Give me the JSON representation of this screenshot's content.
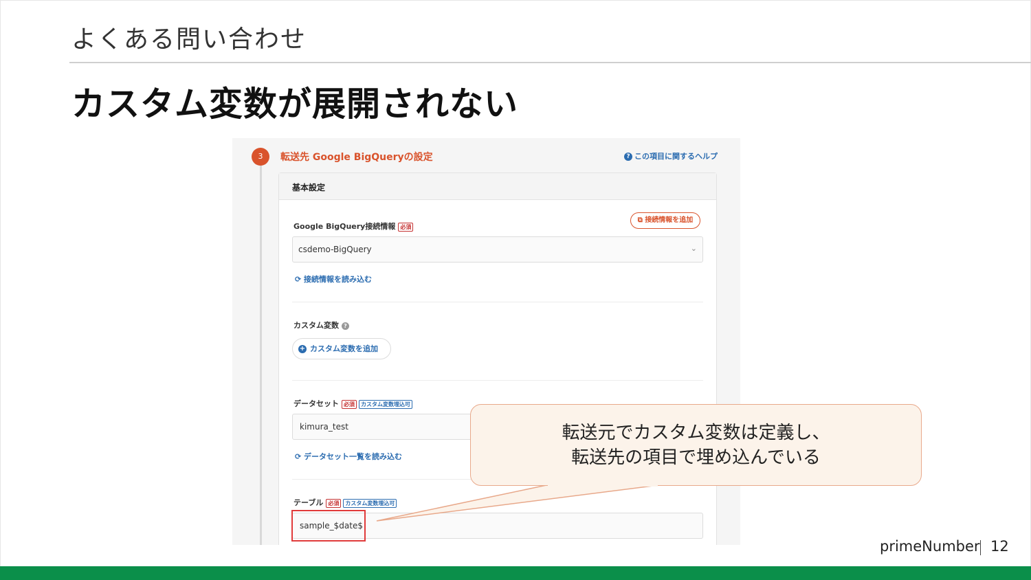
{
  "slide": {
    "section_title": "よくある問い合わせ",
    "title": "カスタム変数が展開されない",
    "brand": "primeNumber",
    "page_number": "12"
  },
  "screenshot": {
    "step_number": "3",
    "step_title": "転送先 Google BigQueryの設定",
    "help_link": "この項目に関するヘルプ",
    "card_header": "基本設定",
    "connection": {
      "label": "Google BigQuery接続情報",
      "required": "必須",
      "add_button": "接続情報を追加",
      "selected_value": "csdemo-BigQuery",
      "reload_link": "接続情報を読み込む"
    },
    "custom_vars": {
      "label": "カスタム変数",
      "add_button": "カスタム変数を追加"
    },
    "dataset": {
      "label": "データセット",
      "required": "必須",
      "tag": "カスタム変数埋込可",
      "value": "kimura_test",
      "reload_link": "データセット一覧を読み込む"
    },
    "table": {
      "label": "テーブル",
      "required": "必須",
      "tag": "カスタム変数埋込可",
      "value": "sample_$date$"
    }
  },
  "callout": {
    "line1": "転送元でカスタム変数は定義し、",
    "line2": "転送先の項目で埋め込んでいる"
  },
  "colors": {
    "accent": "#d9532c",
    "link": "#2b6cb0",
    "footer": "#0b8f4a",
    "callout_bg": "#fcf3ea",
    "callout_border": "#e8a88a",
    "highlight": "#e03a3a"
  }
}
